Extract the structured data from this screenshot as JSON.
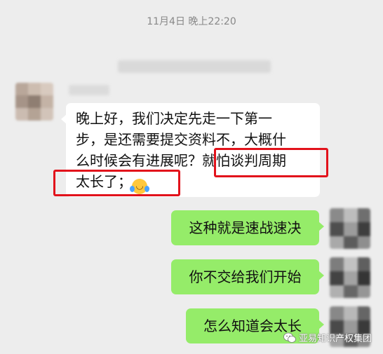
{
  "chat": {
    "timestamp": "11月4日 晚上22:20",
    "incoming": {
      "line1": "晚上好，我们决定先走一下第一",
      "line2": "步，是还需要提交资料不，大概什",
      "line3_plain": "么时候会有进展呢？",
      "line3_highlight": "就怕谈判周期",
      "line4_highlight": "太长了；",
      "emoji": "crying-laughing-emoji"
    },
    "outgoing": [
      {
        "text": "这种就是速战速决"
      },
      {
        "text": "你不交给我们开始"
      },
      {
        "text": "怎么知道会太长"
      }
    ]
  },
  "watermark": {
    "text": "亚易知识产权集团",
    "icon": "wechat-icon"
  },
  "colors": {
    "background": "#ededed",
    "incoming_bubble": "#ffffff",
    "outgoing_bubble": "#95ec69",
    "highlight_box": "#e2121b",
    "timestamp_text": "#888888"
  }
}
